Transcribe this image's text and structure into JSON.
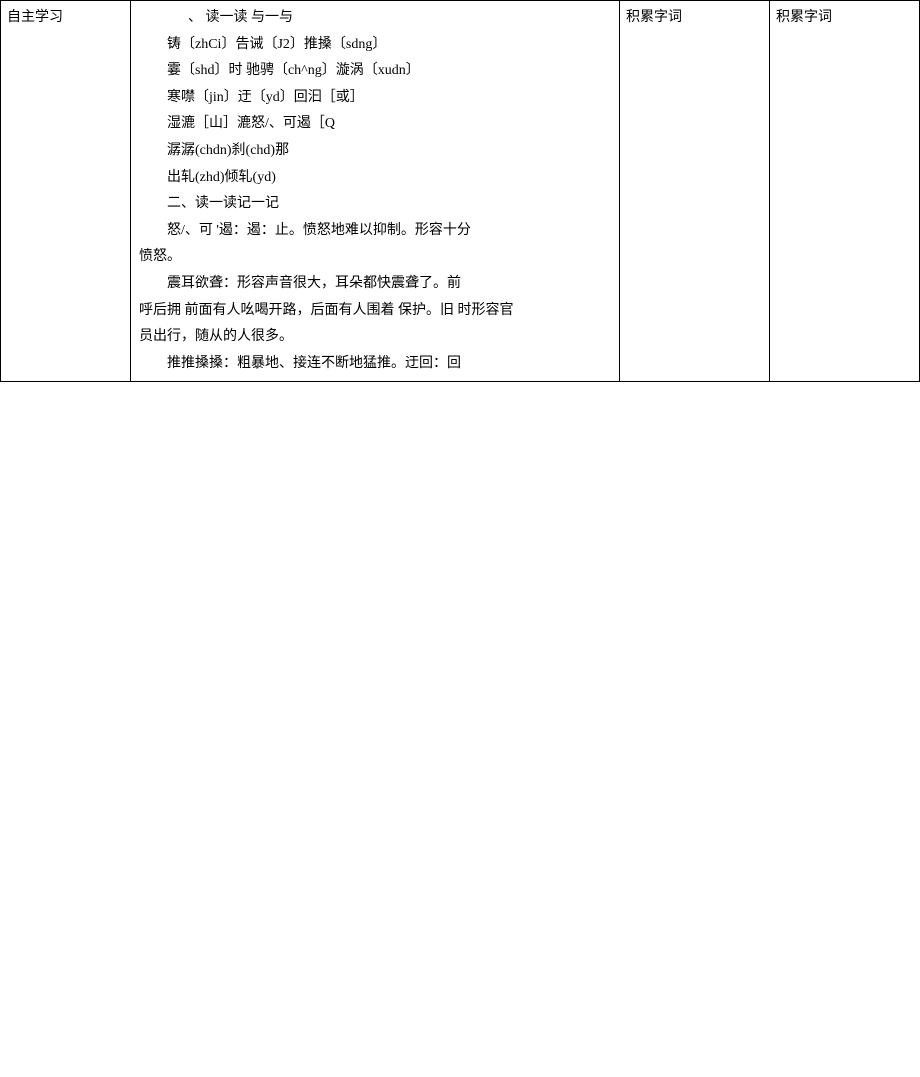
{
  "table": {
    "col1_header": "自主学习",
    "col3_header": "积累字词",
    "col4_header": "积累字词",
    "content": {
      "line1": "、 读一读 与一与",
      "line2": "铸〔zhCi〕告诫〔J2〕推搡〔sdng〕",
      "line3": "霎〔shd〕时 驰骋〔ch^ng〕漩涡〔xudn〕",
      "line4": "寒噤〔jin〕迂〔yd〕回汩［或］",
      "line5": "湿漉［山］漉怒/、可遏［Q",
      "line6": "潺潺(chdn)刹(chd)那",
      "line7": "出轧(zhd)倾轧(yd)",
      "line8": "二、读一读记一记",
      "line9": "怒/、可 '遏：遏：止。愤怒地难以抑制。形容十分",
      "line10": "愤怒。",
      "line11": "震耳欲聋：形容声音很大，耳朵都快震聋了。前",
      "line12": "呼后拥 前面有人吆喝开路，后面有人围着 保护。旧 时形容官",
      "line13": "员出行，随从的人很多。",
      "line14": "推推搡搡：粗暴地、接连不断地猛推。迂回：回"
    }
  }
}
